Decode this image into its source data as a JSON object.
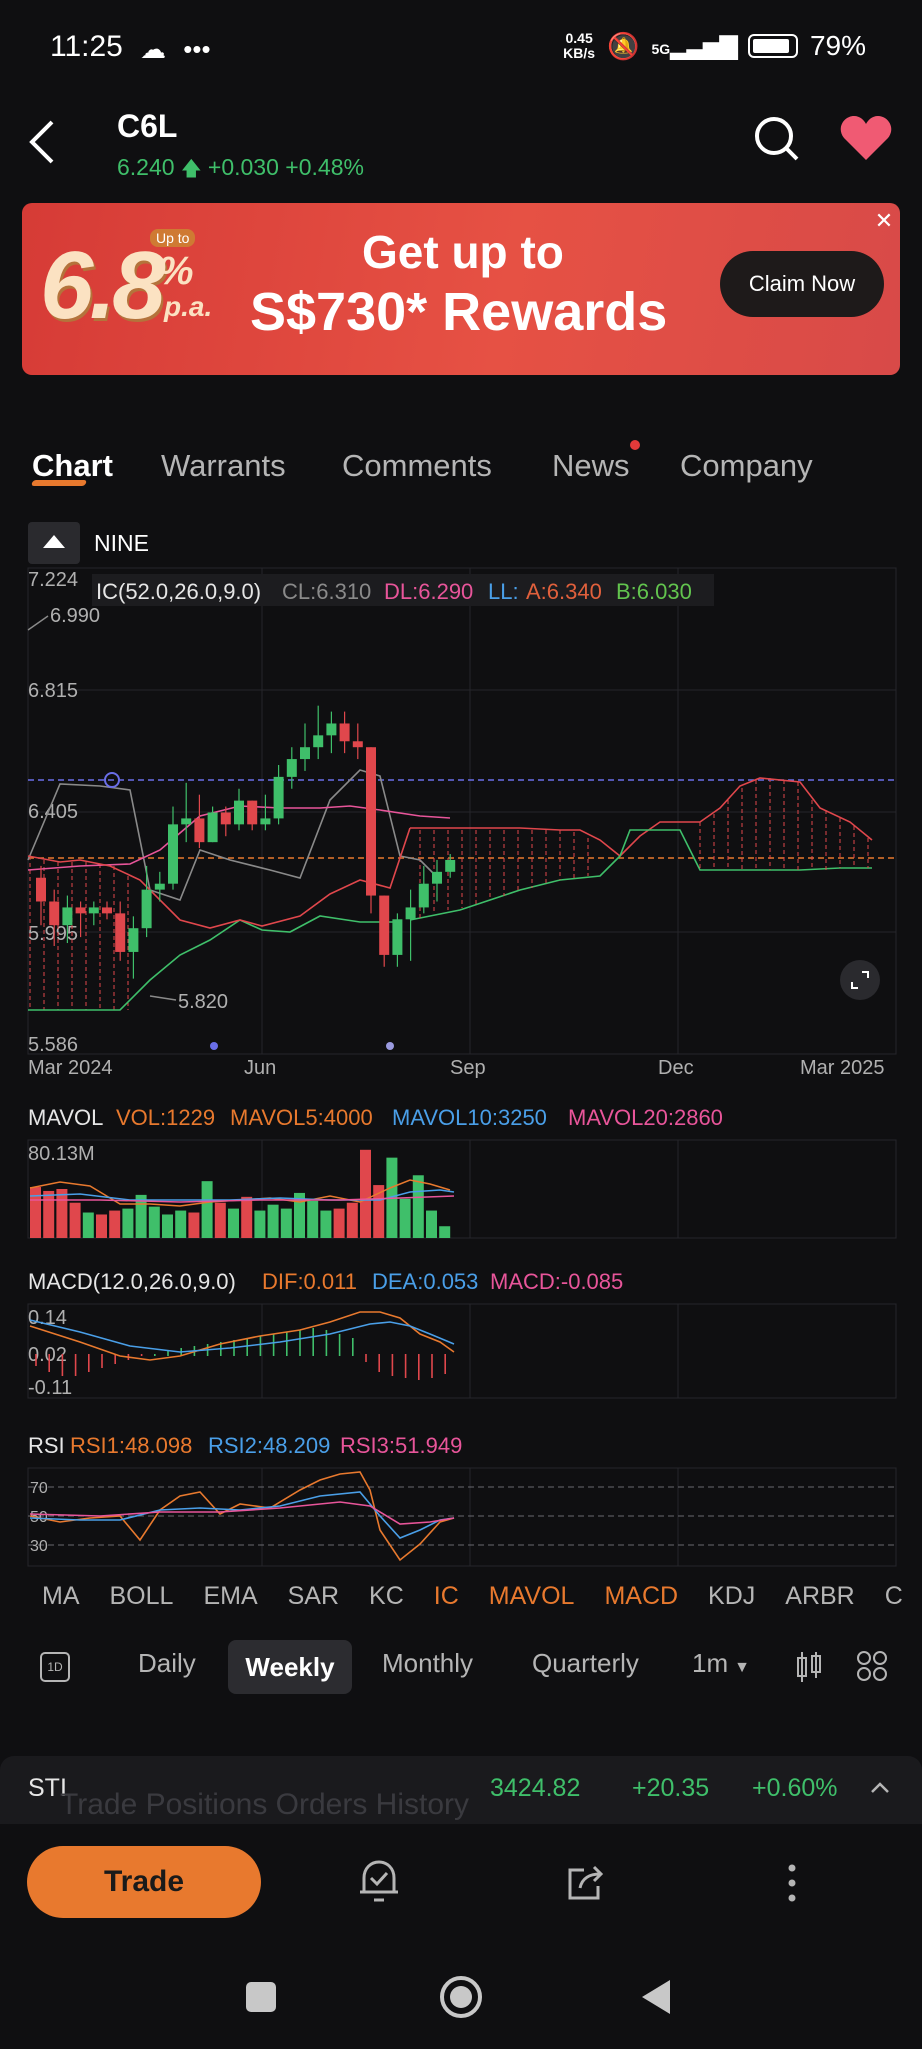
{
  "status": {
    "time": "11:25",
    "speed_value": "0.45",
    "speed_unit": "KB/s",
    "network": "5G",
    "battery": "79%"
  },
  "header": {
    "ticker": "C6L",
    "price": "6.240",
    "change": "+0.030",
    "change_pct": "+0.48%"
  },
  "banner": {
    "big_number": "6.8",
    "up_to_tag": "Up to",
    "percent": "%",
    "pa": "p.a.",
    "line1": "Get up to",
    "line2": "S$730* Rewards",
    "cta": "Claim Now",
    "close": "✕"
  },
  "tabs": [
    "Chart",
    "Warrants",
    "Comments",
    "News",
    "Company"
  ],
  "chart_header": {
    "indicator": "NINE"
  },
  "ic_legend": {
    "title": "IC(52.0,26.0,9.0)",
    "cl": "CL:6.310",
    "dl": "DL:6.290",
    "ll": "LL:",
    "a": "A:6.340",
    "b": "B:6.030"
  },
  "price_axis": [
    "7.224",
    "6.815",
    "6.405",
    "5.995",
    "5.586"
  ],
  "price_annotations": {
    "high": "6.990",
    "low": "5.820"
  },
  "date_axis": [
    "Mar 2024",
    "Jun",
    "Sep",
    "Dec",
    "Mar 2025"
  ],
  "mavol": {
    "title": "MAVOL",
    "vol": "VOL:1229",
    "ma5": "MAVOL5:4000",
    "ma10": "MAVOL10:3250",
    "ma20": "MAVOL20:2860",
    "axis_max": "80.13M"
  },
  "macd": {
    "title": "MACD(12.0,26.0,9.0)",
    "dif": "DIF:0.011",
    "dea": "DEA:0.053",
    "macd": "MACD:-0.085",
    "axis": [
      "0.14",
      "0.02",
      "-0.11"
    ]
  },
  "rsi": {
    "title": "RSI",
    "rsi1": "RSI1:48.098",
    "rsi2": "RSI2:48.209",
    "rsi3": "RSI3:51.949",
    "axis": [
      "70",
      "50",
      "30"
    ]
  },
  "indicator_tabs": [
    "MA",
    "BOLL",
    "EMA",
    "SAR",
    "KC",
    "IC",
    "MAVOL",
    "MACD",
    "KDJ",
    "ARBR",
    "C"
  ],
  "periods": {
    "icon_label": "1D",
    "daily": "Daily",
    "weekly": "Weekly",
    "monthly": "Monthly",
    "quarterly": "Quarterly",
    "minute": "1m"
  },
  "sti": {
    "name": "STI",
    "value": "3424.82",
    "change": "+20.35",
    "change_pct": "+0.60%",
    "ghost_tabs": "Trade      Positions      Orders      History"
  },
  "bottom": {
    "trade": "Trade"
  },
  "colors": {
    "up": "#3fbf6a",
    "down": "#e0474c",
    "accent": "#e8792e",
    "background": "#0f0f11"
  },
  "chart_data": {
    "type": "candlestick",
    "x_labels": [
      "Mar 2024",
      "Jun",
      "Sep",
      "Dec",
      "Mar 2025"
    ],
    "ylim": [
      5.586,
      7.224
    ],
    "ohlc": [
      {
        "o": 6.18,
        "h": 6.22,
        "l": 6.02,
        "c": 6.1
      },
      {
        "o": 6.1,
        "h": 6.14,
        "l": 5.95,
        "c": 6.02
      },
      {
        "o": 6.02,
        "h": 6.12,
        "l": 5.96,
        "c": 6.08
      },
      {
        "o": 6.08,
        "h": 6.1,
        "l": 5.98,
        "c": 6.06
      },
      {
        "o": 6.06,
        "h": 6.1,
        "l": 6.02,
        "c": 6.08
      },
      {
        "o": 6.08,
        "h": 6.1,
        "l": 6.04,
        "c": 6.06
      },
      {
        "o": 6.06,
        "h": 6.1,
        "l": 5.9,
        "c": 5.93
      },
      {
        "o": 5.93,
        "h": 6.05,
        "l": 5.84,
        "c": 6.01
      },
      {
        "o": 6.01,
        "h": 6.22,
        "l": 5.98,
        "c": 6.14
      },
      {
        "o": 6.14,
        "h": 6.2,
        "l": 6.1,
        "c": 6.16
      },
      {
        "o": 6.16,
        "h": 6.42,
        "l": 6.14,
        "c": 6.36
      },
      {
        "o": 6.36,
        "h": 6.5,
        "l": 6.3,
        "c": 6.38
      },
      {
        "o": 6.38,
        "h": 6.46,
        "l": 6.28,
        "c": 6.3
      },
      {
        "o": 6.3,
        "h": 6.42,
        "l": 6.3,
        "c": 6.4
      },
      {
        "o": 6.4,
        "h": 6.42,
        "l": 6.32,
        "c": 6.36
      },
      {
        "o": 6.36,
        "h": 6.48,
        "l": 6.34,
        "c": 6.44
      },
      {
        "o": 6.44,
        "h": 6.44,
        "l": 6.34,
        "c": 6.36
      },
      {
        "o": 6.36,
        "h": 6.46,
        "l": 6.34,
        "c": 6.38
      },
      {
        "o": 6.38,
        "h": 6.56,
        "l": 6.36,
        "c": 6.52
      },
      {
        "o": 6.52,
        "h": 6.62,
        "l": 6.48,
        "c": 6.58
      },
      {
        "o": 6.58,
        "h": 6.7,
        "l": 6.54,
        "c": 6.62
      },
      {
        "o": 6.62,
        "h": 6.76,
        "l": 6.58,
        "c": 6.66
      },
      {
        "o": 6.66,
        "h": 6.74,
        "l": 6.6,
        "c": 6.7
      },
      {
        "o": 6.7,
        "h": 6.74,
        "l": 6.6,
        "c": 6.64
      },
      {
        "o": 6.64,
        "h": 6.7,
        "l": 6.58,
        "c": 6.62
      },
      {
        "o": 6.62,
        "h": 6.62,
        "l": 6.06,
        "c": 6.12
      },
      {
        "o": 6.12,
        "h": 6.12,
        "l": 5.88,
        "c": 5.92
      },
      {
        "o": 5.92,
        "h": 6.06,
        "l": 5.88,
        "c": 6.04
      },
      {
        "o": 6.04,
        "h": 6.14,
        "l": 5.9,
        "c": 6.08
      },
      {
        "o": 6.08,
        "h": 6.22,
        "l": 6.06,
        "c": 6.16
      },
      {
        "o": 6.16,
        "h": 6.24,
        "l": 6.1,
        "c": 6.2
      },
      {
        "o": 6.2,
        "h": 6.26,
        "l": 6.18,
        "c": 6.24
      }
    ],
    "volume": [
      5.2,
      4.8,
      5.0,
      3.6,
      2.6,
      2.4,
      2.8,
      3.0,
      4.4,
      3.2,
      2.4,
      2.8,
      2.6,
      5.8,
      3.6,
      3.0,
      4.2,
      2.8,
      3.4,
      3.0,
      4.6,
      3.8,
      2.8,
      3.0,
      3.6,
      9.0,
      5.4,
      8.2,
      4.0,
      6.4,
      2.8,
      1.2
    ],
    "volume_up": [
      false,
      false,
      false,
      false,
      true,
      false,
      false,
      true,
      true,
      true,
      true,
      true,
      false,
      true,
      false,
      true,
      false,
      true,
      true,
      true,
      true,
      true,
      true,
      false,
      false,
      false,
      false,
      true,
      true,
      true,
      true,
      true
    ]
  }
}
